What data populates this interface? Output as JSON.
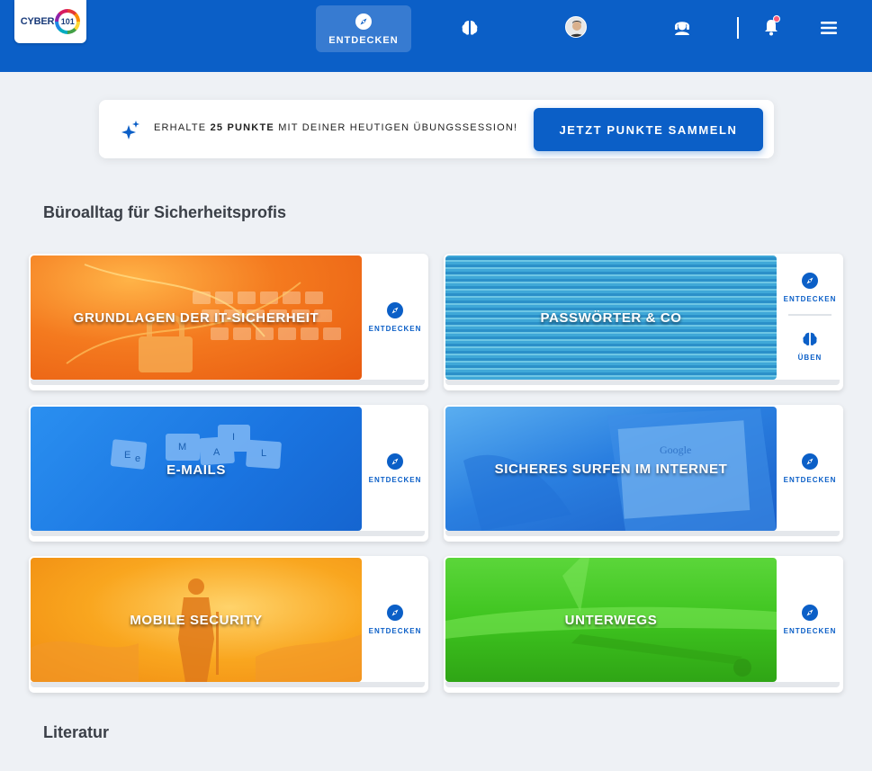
{
  "header": {
    "logo": {
      "text": "CYBER",
      "number": "101"
    },
    "nav": {
      "active_label": "ENTDECKEN",
      "icons": [
        "compass-icon",
        "brain-icon",
        "avatar",
        "support-icon",
        "bell-icon",
        "menu-icon"
      ]
    },
    "notification_dot_color": "#ff5a78",
    "brand_color": "#0b5fc7"
  },
  "promo": {
    "prefix": "ERHALTE",
    "points": "25 PUNKTE",
    "suffix": "MIT DEINER HEUTIGEN ÜBUNGSSESSION!",
    "button": "JETZT PUNKTE SAMMELN"
  },
  "sections": [
    {
      "title": "Büroalltag für Sicherheitsprofis",
      "cards": [
        {
          "title": "GRUNDLAGEN DER IT-SICHERHEIT",
          "actions": [
            "ENTDECKEN"
          ]
        },
        {
          "title": "PASSWÖRTER & CO",
          "actions": [
            "ENTDECKEN",
            "ÜBEN"
          ]
        },
        {
          "title": "E-MAILS",
          "actions": [
            "ENTDECKEN"
          ]
        },
        {
          "title": "SICHERES SURFEN IM INTERNET",
          "actions": [
            "ENTDECKEN"
          ]
        },
        {
          "title": "MOBILE SECURITY",
          "actions": [
            "ENTDECKEN"
          ]
        },
        {
          "title": "UNTERWEGS",
          "actions": [
            "ENTDECKEN"
          ]
        }
      ]
    },
    {
      "title": "Literatur"
    }
  ],
  "decor": {
    "email_tiles": [
      "E",
      "e",
      "M",
      "A",
      "I",
      "L"
    ],
    "google_text": "Google"
  }
}
